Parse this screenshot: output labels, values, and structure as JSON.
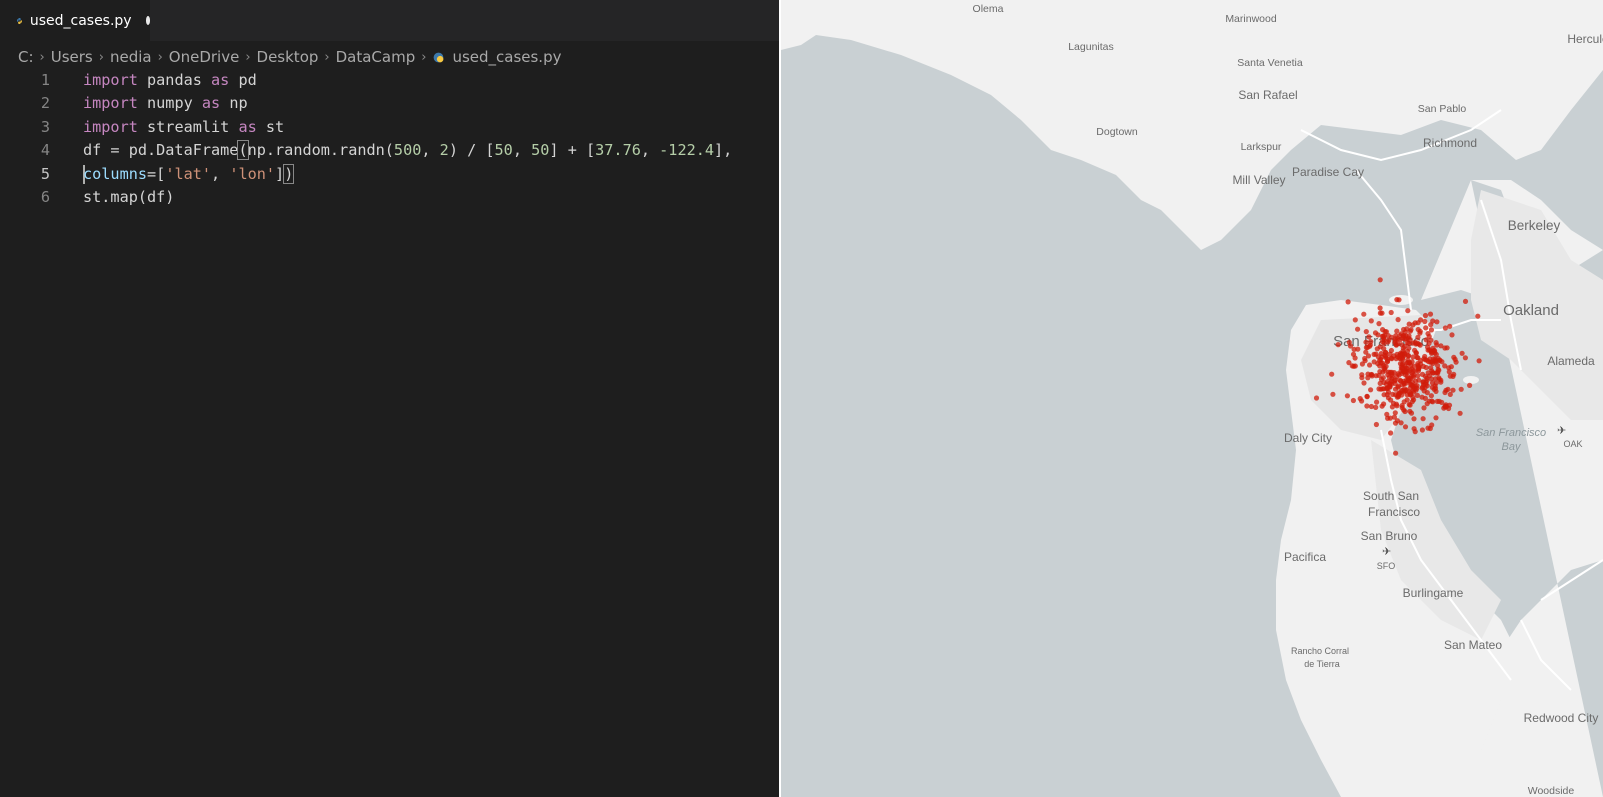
{
  "editor": {
    "tab": {
      "filename": "used_cases.py",
      "icon": "python-icon",
      "unsaved": true
    },
    "breadcrumb": [
      "C:",
      "Users",
      "nedia",
      "OneDrive",
      "Desktop",
      "DataCamp",
      "used_cases.py"
    ],
    "current_line": 5,
    "lines": [
      {
        "n": "1",
        "tokens": [
          {
            "t": "import",
            "c": "kw"
          },
          {
            "t": " pandas "
          },
          {
            "t": "as",
            "c": "kw"
          },
          {
            "t": " pd"
          }
        ]
      },
      {
        "n": "2",
        "tokens": [
          {
            "t": "import",
            "c": "kw"
          },
          {
            "t": " numpy "
          },
          {
            "t": "as",
            "c": "kw"
          },
          {
            "t": " np"
          }
        ]
      },
      {
        "n": "3",
        "tokens": [
          {
            "t": "import",
            "c": "kw"
          },
          {
            "t": " streamlit "
          },
          {
            "t": "as",
            "c": "kw"
          },
          {
            "t": " st"
          }
        ]
      },
      {
        "n": "4",
        "tokens": [
          {
            "t": "df = pd.DataFrame"
          },
          {
            "t": "(",
            "c": "bracket"
          },
          {
            "t": "np.random.randn("
          },
          {
            "t": "500",
            "c": "num"
          },
          {
            "t": ", "
          },
          {
            "t": "2",
            "c": "num"
          },
          {
            "t": ") / ["
          },
          {
            "t": "50",
            "c": "num"
          },
          {
            "t": ", "
          },
          {
            "t": "50",
            "c": "num"
          },
          {
            "t": "] + ["
          },
          {
            "t": "37.76",
            "c": "num"
          },
          {
            "t": ", "
          },
          {
            "t": "-122.4",
            "c": "num"
          },
          {
            "t": "],"
          }
        ]
      },
      {
        "n": "5",
        "tokens": [
          {
            "t": "",
            "c": "cursor"
          },
          {
            "t": "columns",
            "c": "param"
          },
          {
            "t": "=["
          },
          {
            "t": "'lat'",
            "c": "str"
          },
          {
            "t": ", "
          },
          {
            "t": "'lon'",
            "c": "str"
          },
          {
            "t": "]"
          },
          {
            "t": ")",
            "c": "bracket"
          }
        ]
      },
      {
        "n": "6",
        "tokens": [
          {
            "t": "st.map(df)"
          }
        ]
      }
    ]
  },
  "map": {
    "colors": {
      "water": "#c9d0d3",
      "land": "#f2f2f2",
      "point": "#d01c0b"
    },
    "point_center": {
      "lat": 37.76,
      "lon": -122.4
    },
    "point_count": 500,
    "places": [
      {
        "name": "Olema",
        "size": "small"
      },
      {
        "name": "Marinwood",
        "size": "small"
      },
      {
        "name": "Hercules",
        "size": "medium"
      },
      {
        "name": "Lagunitas",
        "size": "small"
      },
      {
        "name": "Santa Venetia",
        "size": "small"
      },
      {
        "name": "San Rafael",
        "size": "medium"
      },
      {
        "name": "San Pablo",
        "size": "small"
      },
      {
        "name": "Dogtown",
        "size": "small"
      },
      {
        "name": "Larkspur",
        "size": "small"
      },
      {
        "name": "Richmond",
        "size": "medium"
      },
      {
        "name": "Paradise Cay",
        "size": "medium"
      },
      {
        "name": "Mill Valley",
        "size": "medium"
      },
      {
        "name": "Berkeley",
        "size": "large"
      },
      {
        "name": "Oakland",
        "size": "xlarge"
      },
      {
        "name": "San Francisco",
        "size": "xlarge"
      },
      {
        "name": "Alameda",
        "size": "medium"
      },
      {
        "name": "Daly City",
        "size": "medium"
      },
      {
        "name": "South San",
        "size": "medium"
      },
      {
        "name": "Francisco",
        "size": "medium"
      },
      {
        "name": "San Bruno",
        "size": "medium"
      },
      {
        "name": "Pacifica",
        "size": "medium"
      },
      {
        "name": "SFO",
        "size": "tiny"
      },
      {
        "name": "Burlingame",
        "size": "medium"
      },
      {
        "name": "San Mateo",
        "size": "medium"
      },
      {
        "name": "Rancho Corral",
        "size": "tiny"
      },
      {
        "name": "de Tierra",
        "size": "tiny"
      },
      {
        "name": "Redwood City",
        "size": "medium"
      },
      {
        "name": "Woodside",
        "size": "small"
      },
      {
        "name": "OAK",
        "size": "tiny"
      }
    ],
    "water_labels": [
      "San Francisco",
      "Bay"
    ]
  }
}
